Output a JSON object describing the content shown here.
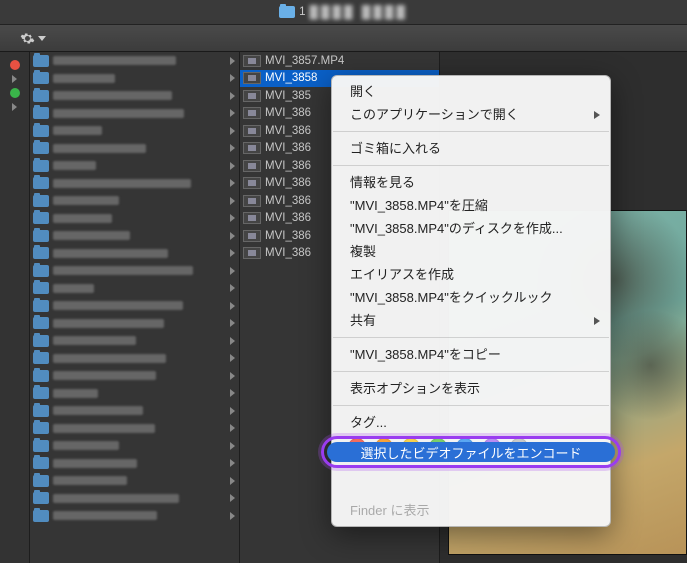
{
  "pathbar": {
    "title": "1"
  },
  "col1": {
    "dots": [
      "red",
      "dark",
      "green",
      "dark"
    ]
  },
  "sidebar_item_count": 27,
  "files": [
    {
      "name": "MVI_3857.MP4",
      "selected": false
    },
    {
      "name": "MVI_3858",
      "selected": true
    },
    {
      "name": "MVI_385",
      "selected": false
    },
    {
      "name": "MVI_386",
      "selected": false
    },
    {
      "name": "MVI_386",
      "selected": false
    },
    {
      "name": "MVI_386",
      "selected": false
    },
    {
      "name": "MVI_386",
      "selected": false
    },
    {
      "name": "MVI_386",
      "selected": false
    },
    {
      "name": "MVI_386",
      "selected": false
    },
    {
      "name": "MVI_386",
      "selected": false
    },
    {
      "name": "MVI_386",
      "selected": false
    },
    {
      "name": "MVI_386",
      "selected": false
    }
  ],
  "context_menu": {
    "open": "開く",
    "open_with": "このアプリケーションで開く",
    "trash": "ゴミ箱に入れる",
    "get_info": "情報を見る",
    "compress": "\"MVI_3858.MP4\"を圧縮",
    "burn": "\"MVI_3858.MP4\"のディスクを作成...",
    "duplicate": "複製",
    "alias": "エイリアスを作成",
    "quicklook": "\"MVI_3858.MP4\"をクイックルック",
    "share": "共有",
    "copy": "\"MVI_3858.MP4\"をコピー",
    "view_options": "表示オプションを表示",
    "tags_label": "タグ...",
    "encode": "選択したビデオファイルをエンコード",
    "reveal": "Finder に表示"
  },
  "tag_colors": [
    "t-red",
    "t-orange",
    "t-yellow",
    "t-green",
    "t-blue",
    "t-purple",
    "t-gray"
  ]
}
